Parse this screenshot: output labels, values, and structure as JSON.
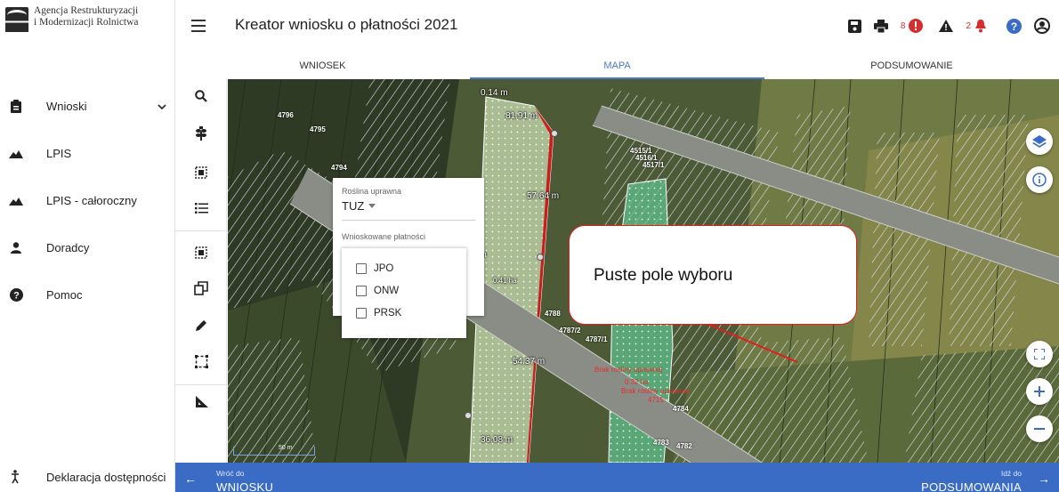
{
  "logo": {
    "line1": "Agencja Restrukturyzacji",
    "line2": "i Modernizacji Rolnictwa",
    "mark_text": "ARiMR"
  },
  "sidebar": {
    "items": [
      {
        "label": "Wnioski",
        "icon": "clipboard-icon"
      },
      {
        "label": "LPIS",
        "icon": "mountain-icon"
      },
      {
        "label": "LPIS - całoroczny",
        "icon": "mountain-icon"
      },
      {
        "label": "Doradcy",
        "icon": "person-icon"
      },
      {
        "label": "Pomoc",
        "icon": "help-circle-icon"
      }
    ],
    "accessibility": "Deklaracja dostępności"
  },
  "header": {
    "title": "Kreator wniosku o płatności 2021",
    "error_count": "8",
    "warning_count": "2"
  },
  "tabs": [
    {
      "label": "WNIOSEK",
      "active": false
    },
    {
      "label": "MAPA",
      "active": true
    },
    {
      "label": "PODSUMOWANIE",
      "active": false
    }
  ],
  "map": {
    "parcel_labels": [
      "4796",
      "4795",
      "4794",
      "4515/1",
      "4516/1",
      "4517/1",
      "4788",
      "4787/2",
      "4787/1",
      "4784",
      "4783",
      "4782"
    ],
    "measurements": [
      "0.14 m",
      "81.91 m",
      "57.64 m",
      "1 m",
      "0.41 ha",
      "54.37 m",
      "36.08 m"
    ],
    "red_notes": [
      "Brak rośliny uprawnej",
      "0.32 ha",
      "Brak rośliny uprawnej",
      "4715"
    ],
    "scale": "50 m"
  },
  "panel": {
    "crop_label": "Roślina uprawna",
    "crop_value": "TUZ",
    "payments_label": "Wnioskowane płatności",
    "options": [
      "JPO",
      "ONW",
      "PRSK"
    ]
  },
  "callout": {
    "text": "Puste pole wyboru"
  },
  "footer": {
    "back_small": "Wróć do",
    "back_big": "WNIOSKU",
    "next_small": "Idź do",
    "next_big": "PODSUMOWANIA"
  },
  "colors": {
    "accent": "#3a6cc5",
    "error": "#d32f2f",
    "help": "#3a6cc5"
  }
}
